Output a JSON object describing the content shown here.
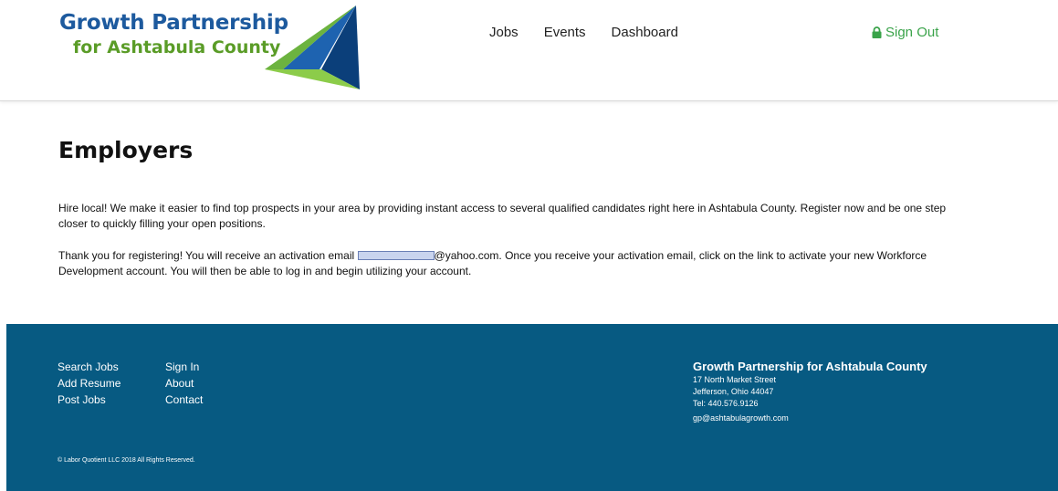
{
  "header": {
    "logo": {
      "line1": "Growth Partnership",
      "line2": "for Ashtabula County",
      "colors": {
        "blue": "#1d5a9e",
        "green": "#5a9c27"
      }
    },
    "nav": [
      {
        "label": "Jobs"
      },
      {
        "label": "Events"
      },
      {
        "label": "Dashboard"
      }
    ],
    "sign_out": {
      "label": "Sign Out",
      "icon": "lock-icon",
      "color": "#3aa34a"
    }
  },
  "main": {
    "title": "Employers",
    "intro": "Hire local! We make it easier to find top prospects in your area by providing instant access to several qualified candidates right here in Ashtabula County. Register now and be one step closer to quickly filling your open positions.",
    "confirmation": {
      "before": "Thank you for registering! You will receive an activation email ",
      "after": "@yahoo.com. Once you receive your activation email, click on the link to activate your new Workforce Development account. You will then be able to log in and begin utilizing your account."
    }
  },
  "footer": {
    "background": "#075a82",
    "links_col1": [
      {
        "label": "Search Jobs"
      },
      {
        "label": "Add Resume"
      },
      {
        "label": "Post Jobs"
      }
    ],
    "links_col2": [
      {
        "label": "Sign In"
      },
      {
        "label": "About"
      },
      {
        "label": "Contact"
      }
    ],
    "org": {
      "name": "Growth Partnership for Ashtabula County",
      "address1": "17 North Market Street",
      "address2": "Jefferson, Ohio 44047",
      "tel": "Tel: 440.576.9126",
      "email": "gp@ashtabulagrowth.com"
    },
    "copyright": "© Labor Quotient LLC 2018 All Rights Reserved."
  }
}
